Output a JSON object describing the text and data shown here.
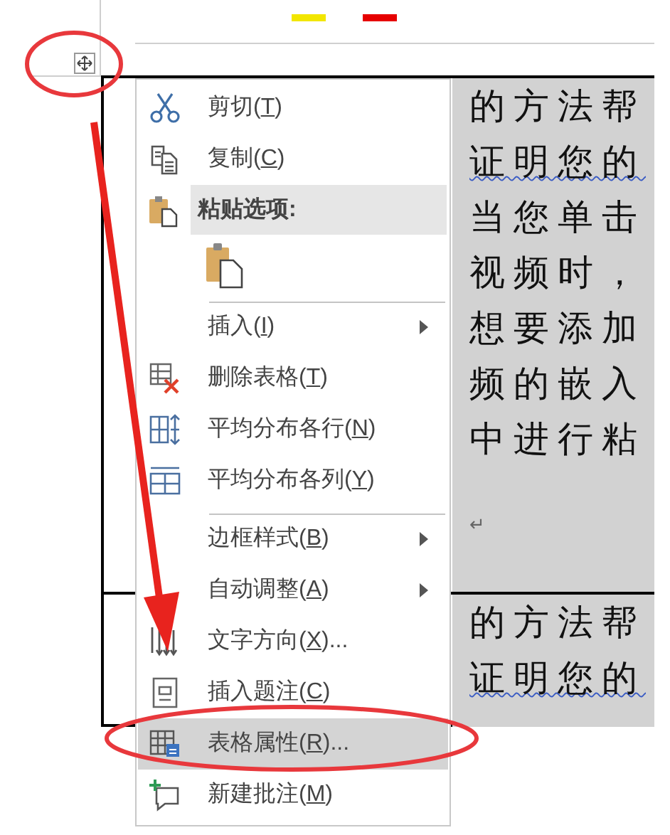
{
  "context_menu": {
    "items": [
      {
        "kind": "item",
        "text_before": "剪切(",
        "accelerator": "T",
        "text_after": ")",
        "submenu": false,
        "selected": false,
        "divider_above": false
      },
      {
        "kind": "item",
        "text_before": "复制(",
        "accelerator": "C",
        "text_after": ")",
        "submenu": false,
        "selected": false,
        "divider_above": false
      },
      {
        "kind": "header",
        "text_before": "粘贴选项:",
        "submenu": false,
        "selected": false,
        "divider_above": false
      },
      {
        "kind": "paste",
        "submenu": false,
        "selected": false,
        "divider_above": false
      },
      {
        "kind": "item",
        "text_before": "插入(",
        "accelerator": "I",
        "text_after": ")",
        "submenu": true,
        "selected": false,
        "divider_above": true
      },
      {
        "kind": "item",
        "text_before": "删除表格(",
        "accelerator": "T",
        "text_after": ")",
        "submenu": false,
        "selected": false,
        "divider_above": false
      },
      {
        "kind": "item",
        "text_before": "平均分布各行(",
        "accelerator": "N",
        "text_after": ")",
        "submenu": false,
        "selected": false,
        "divider_above": false
      },
      {
        "kind": "item",
        "text_before": "平均分布各列(",
        "accelerator": "Y",
        "text_after": ")",
        "submenu": false,
        "selected": false,
        "divider_above": false
      },
      {
        "kind": "item",
        "text_before": "边框样式(",
        "accelerator": "B",
        "text_after": ")",
        "submenu": true,
        "selected": false,
        "divider_above": true
      },
      {
        "kind": "item",
        "text_before": "自动调整(",
        "accelerator": "A",
        "text_after": ")",
        "submenu": true,
        "selected": false,
        "divider_above": false
      },
      {
        "kind": "item",
        "text_before": "文字方向(",
        "accelerator": "X",
        "text_after": ")...",
        "submenu": false,
        "selected": false,
        "divider_above": false
      },
      {
        "kind": "item",
        "text_before": "插入题注(",
        "accelerator": "C",
        "text_after": ")",
        "submenu": false,
        "selected": false,
        "divider_above": false
      },
      {
        "kind": "item",
        "text_before": "表格属性(",
        "accelerator": "R",
        "text_after": ")...",
        "submenu": false,
        "selected": true,
        "divider_above": false
      },
      {
        "kind": "item",
        "text_before": "新建批注(",
        "accelerator": "M",
        "text_after": ")",
        "submenu": false,
        "selected": false,
        "divider_above": false
      }
    ]
  },
  "document": {
    "table_cells": [
      {
        "lines": [
          {
            "text": "的方法帮",
            "misspelled": false
          },
          {
            "text": "证明您的",
            "misspelled": true
          },
          {
            "text": "当您单击",
            "misspelled": false
          },
          {
            "text": "视频时，",
            "misspelled": false
          },
          {
            "text": "想要添加",
            "misspelled": false
          },
          {
            "text": "频的嵌入",
            "misspelled": false
          },
          {
            "text": "中进行粘",
            "misspelled": false
          }
        ],
        "paragraph_mark": "↵"
      },
      {
        "lines": [
          {
            "text": "的方法帮",
            "misspelled": false
          },
          {
            "text": "证明您的",
            "misspelled": true
          }
        ]
      }
    ]
  }
}
